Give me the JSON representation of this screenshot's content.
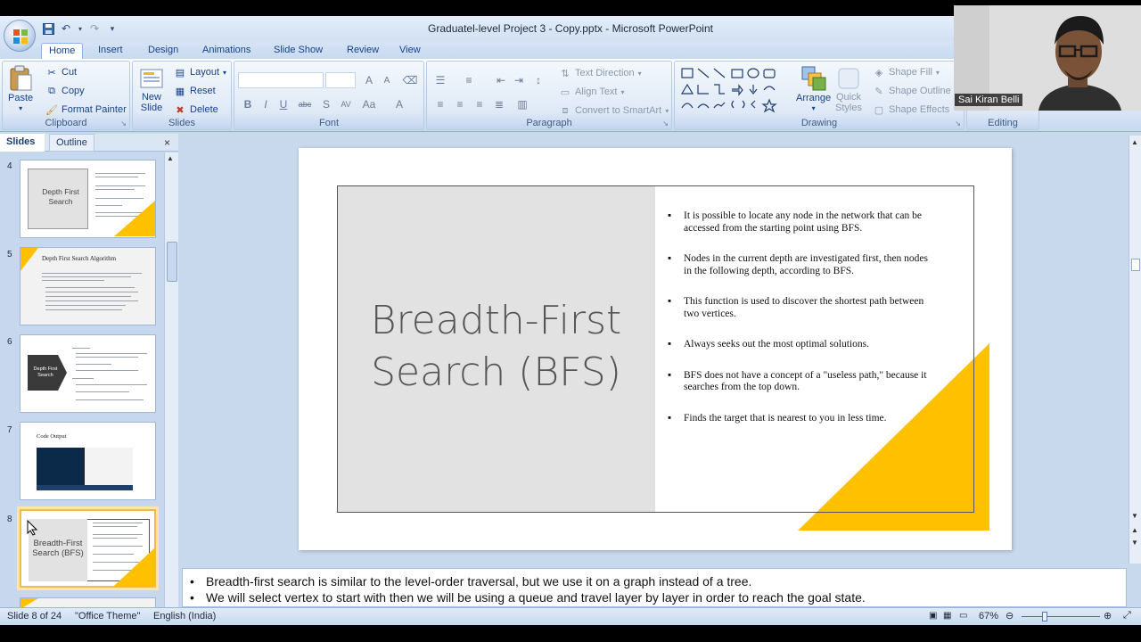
{
  "window": {
    "title": "Graduatel-level Project 3 - Copy.pptx - Microsoft PowerPoint"
  },
  "ribbon": {
    "tabs": [
      "Home",
      "Insert",
      "Design",
      "Animations",
      "Slide Show",
      "Review",
      "View"
    ],
    "active_tab": "Home",
    "clipboard": {
      "paste": "Paste",
      "cut": "Cut",
      "copy": "Copy",
      "format_painter": "Format Painter",
      "label": "Clipboard"
    },
    "slides": {
      "new_slide_1": "New",
      "new_slide_2": "Slide",
      "layout": "Layout",
      "reset": "Reset",
      "delete": "Delete",
      "label": "Slides"
    },
    "font": {
      "label": "Font"
    },
    "paragraph": {
      "text_direction": "Text Direction",
      "align_text": "Align Text",
      "convert_smartart": "Convert to SmartArt",
      "label": "Paragraph"
    },
    "drawing": {
      "arrange": "Arrange",
      "quick_styles_1": "Quick",
      "quick_styles_2": "Styles",
      "shape_fill": "Shape Fill",
      "shape_outline": "Shape Outline",
      "shape_effects": "Shape Effects",
      "label": "Drawing"
    },
    "editing": {
      "label": "Editing"
    }
  },
  "pane": {
    "tab_slides": "Slides",
    "tab_outline": "Outline",
    "close": "×",
    "thumbnails": [
      {
        "num": "4",
        "title": "Depth First Search"
      },
      {
        "num": "5",
        "title": "Depth First Search Algorithm"
      },
      {
        "num": "6",
        "title": "Depth First Search"
      },
      {
        "num": "7",
        "title": "Code Output"
      },
      {
        "num": "8",
        "title": "Breadth-First Search (BFS)"
      }
    ]
  },
  "slide": {
    "title_line1": "Breadth-First",
    "title_line2": "Search (BFS)",
    "bullets": [
      "It is possible to locate any node in the network that can be accessed from the starting point using BFS.",
      "Nodes in the current depth are investigated first, then nodes in the following depth, according to BFS.",
      "This function is used to discover the shortest path between two vertices.",
      "Always seeks out the most optimal solutions.",
      "BFS does not have a concept of a \"useless path,\" because it searches from the top down.",
      "Finds the target that is nearest to you in less time."
    ],
    "accent_color": "#FFC000"
  },
  "notes": [
    "Breadth-first search is similar to the level-order traversal, but we use it on a graph instead of a tree.",
    "We will select vertex to start with then we will be using a queue  and travel layer by layer in order to reach the goal state."
  ],
  "status": {
    "slide_counter": "Slide 8 of 24",
    "theme": "\"Office Theme\"",
    "language": "English (India)",
    "zoom": "67%"
  },
  "webcam": {
    "name": "Sai Kiran Belli"
  }
}
